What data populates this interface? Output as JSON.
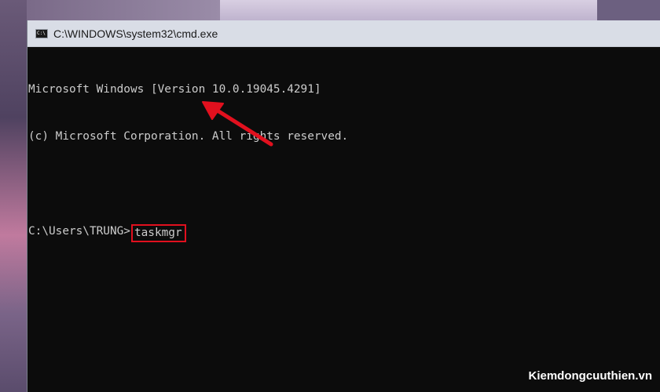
{
  "window": {
    "title": "C:\\WINDOWS\\system32\\cmd.exe",
    "icon": "cmd-icon",
    "icon_text": "C:\\"
  },
  "console": {
    "line1": "Microsoft Windows [Version 10.0.19045.4291]",
    "line2": "(c) Microsoft Corporation. All rights reserved.",
    "prompt": "C:\\Users\\TRUNG>",
    "command": "taskmgr"
  },
  "annotation": {
    "color": "#e1101e",
    "arrow_icon": "red-arrow-icon"
  },
  "watermark": "Kiemdongcuuthien.vn"
}
